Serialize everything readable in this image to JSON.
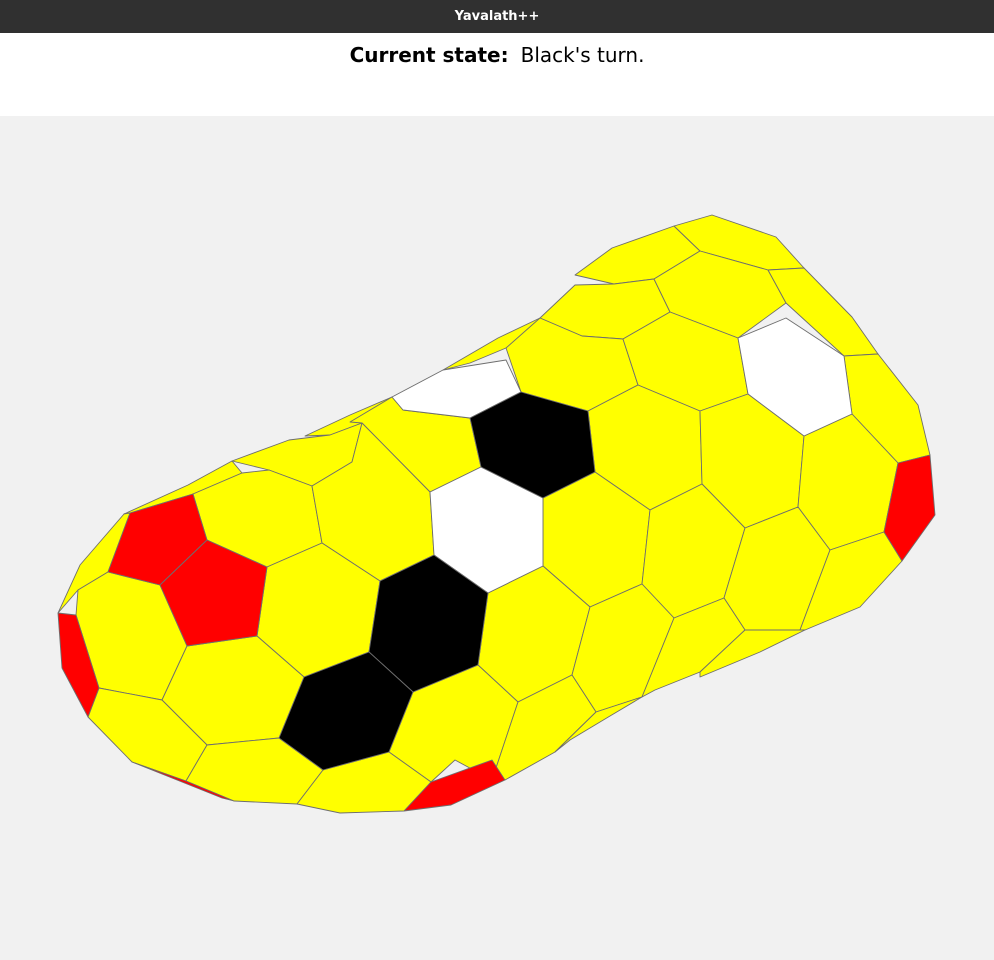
{
  "window": {
    "title": "Yavalath++"
  },
  "status": {
    "label": "Current state:",
    "value": "Black's turn."
  },
  "colors": {
    "background": "#f1f1f1",
    "empty": "#ffff00",
    "black": "#000000",
    "white": "#ffffff",
    "red": "#ff0000",
    "grid": "#6e6e6e"
  },
  "board": {
    "pieces": {
      "black": 3,
      "white": 3
    },
    "red_cells": 5
  }
}
